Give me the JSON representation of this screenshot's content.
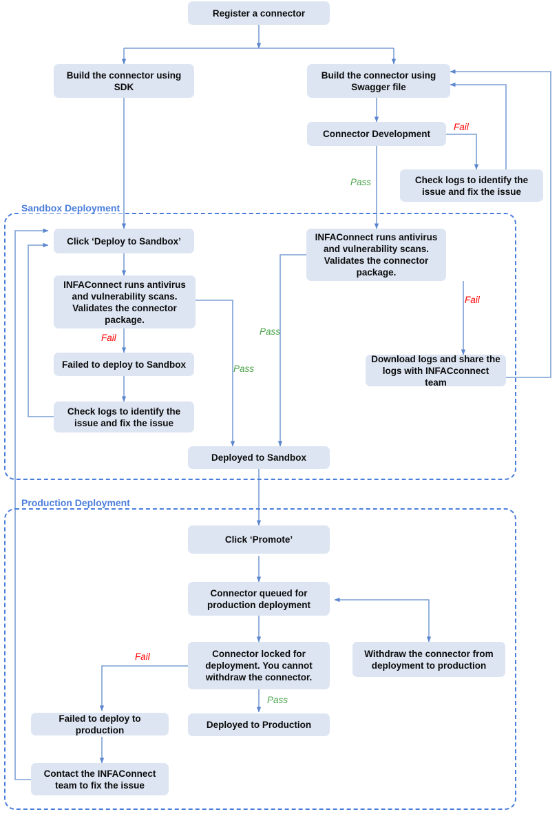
{
  "diagram": {
    "title": "Connector registration, sandbox and production deployment flow",
    "colors": {
      "node_fill": "#dde5f2",
      "node_text": "#0c0c0c",
      "edge_line": "#7b9fd4",
      "group_border": "#4a7ddb",
      "group_label": "#4a7ddb",
      "fail_label": "#ff0000",
      "pass_label": "#49a349"
    },
    "groups": [
      {
        "id": "sandbox",
        "label": "Sandbox Deployment"
      },
      {
        "id": "production",
        "label": "Production Deployment"
      }
    ],
    "nodes": [
      {
        "id": "register",
        "label": "Register a connector"
      },
      {
        "id": "build_sdk",
        "label": "Build the connector using SDK"
      },
      {
        "id": "build_swagger",
        "label": "Build the connector using Swagger file"
      },
      {
        "id": "connector_dev",
        "label": "Connector Development"
      },
      {
        "id": "check_logs_dev",
        "label": "Check logs to identify the issue and fix the issue"
      },
      {
        "id": "click_deploy",
        "label": "Click ‘Deploy to Sandbox’"
      },
      {
        "id": "scan_left",
        "label": "INFAConnect runs antivirus and vulnerability scans. Validates the connector package."
      },
      {
        "id": "scan_right",
        "label": "INFAConnect runs antivirus and vulnerability scans. Validates the connector package."
      },
      {
        "id": "failed_sandbox",
        "label": "Failed to deploy to Sandbox"
      },
      {
        "id": "check_logs_sbx",
        "label": "Check logs to identify the issue and fix the issue"
      },
      {
        "id": "download_logs",
        "label": "Download logs and share the logs with INFACconnect team"
      },
      {
        "id": "deployed_sandbox",
        "label": "Deployed to Sandbox"
      },
      {
        "id": "click_promote",
        "label": "Click ‘Promote’"
      },
      {
        "id": "queued_prod",
        "label": "Connector queued for production deployment"
      },
      {
        "id": "locked_prod",
        "label": "Connector locked for deployment. You cannot withdraw the connector."
      },
      {
        "id": "withdraw",
        "label": "Withdraw the connector from deployment to production"
      },
      {
        "id": "failed_prod",
        "label": "Failed to deploy to production"
      },
      {
        "id": "deployed_prod",
        "label": "Deployed to Production"
      },
      {
        "id": "contact_team",
        "label": "Contact the INFAConnect team to fix the issue"
      }
    ],
    "edge_labels": [
      {
        "id": "fail_dev",
        "text": "Fail"
      },
      {
        "id": "pass_dev",
        "text": "Pass"
      },
      {
        "id": "fail_scan_left",
        "text": "Fail"
      },
      {
        "id": "pass_scan_left",
        "text": "Pass"
      },
      {
        "id": "fail_scan_right",
        "text": "Fail"
      },
      {
        "id": "pass_scan_right",
        "text": "Pass"
      },
      {
        "id": "fail_locked",
        "text": "Fail"
      },
      {
        "id": "pass_locked",
        "text": "Pass"
      }
    ]
  }
}
